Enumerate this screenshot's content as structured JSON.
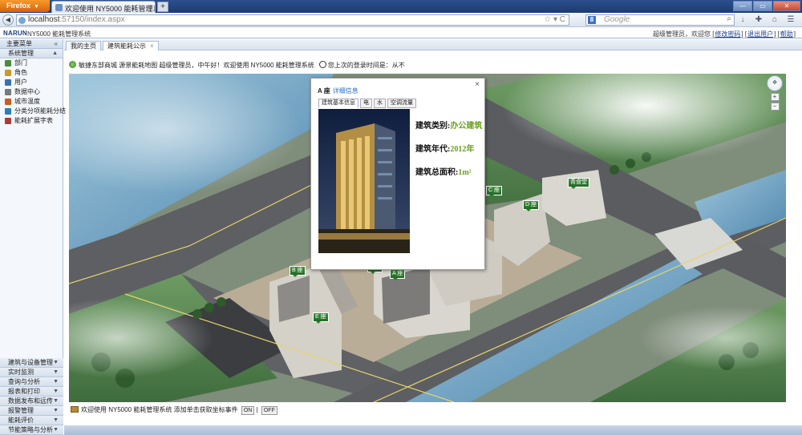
{
  "browser": {
    "menu_button": "Firefox",
    "tab_title": "欢迎使用 NY5000 能耗管理系统",
    "new_tab": "+",
    "url_host": "localhost",
    "url_rest": ":57150/index.aspx",
    "search_placeholder": "Google",
    "search_engine_letter": "8"
  },
  "app": {
    "logo": "NARUN",
    "title": "NY5000 能耗管理系统",
    "user_text": "超级管理员，欢迎您",
    "link_change_password": "修改密码",
    "link_logout": "退出用户",
    "link_help": "帮助"
  },
  "sidebar": {
    "header": "主要菜单",
    "collapse_icon": "«",
    "section_active": "系统管理",
    "items": [
      {
        "label": "部门",
        "color": "#4a8c3a"
      },
      {
        "label": "角色",
        "color": "#c79a2a"
      },
      {
        "label": "用户",
        "color": "#3a6fb0"
      },
      {
        "label": "数据中心",
        "color": "#7a7a7a"
      },
      {
        "label": "城市温度",
        "color": "#d05a1c"
      },
      {
        "label": "分类分项能耗分结",
        "color": "#2a7fb8"
      },
      {
        "label": "能耗扩展字表",
        "color": "#b03a3a"
      }
    ],
    "sections_bottom": [
      "建筑与设备管理",
      "实时监测",
      "查询与分析",
      "报表和打印",
      "数据发布和远传",
      "报警管理",
      "能耗评价",
      "节能策略与分析"
    ]
  },
  "content_tabs": [
    {
      "label": "我的主页",
      "active": false
    },
    {
      "label": "建筑能耗公示",
      "active": true
    }
  ],
  "welcome": {
    "message": "敏捷东部商城 源景能耗地图 超级管理员，中午好！欢迎使用 NY5000 能耗管理系统",
    "last_login": "您上次的登录时间是：从不"
  },
  "map": {
    "building_labels": [
      "B 座",
      "A 座",
      "C 座",
      "D 座",
      "E 座",
      "F 座",
      "青食堂"
    ]
  },
  "popup": {
    "title": "A 座",
    "detail_link": "详细信息",
    "close": "×",
    "tabs": [
      "建筑基本信息",
      "电",
      "水",
      "空调流量"
    ],
    "fields": [
      {
        "label": "建筑类别:",
        "value": "办公建筑"
      },
      {
        "label": "建筑年代:",
        "value": "2012年"
      },
      {
        "label": "建筑总面积:",
        "value": "1m²"
      }
    ]
  },
  "bottom": {
    "message": "欢迎使用 NY5000 能耗管理系统 添加单击获取坐标事件",
    "on": "ON",
    "off": "OFF"
  }
}
